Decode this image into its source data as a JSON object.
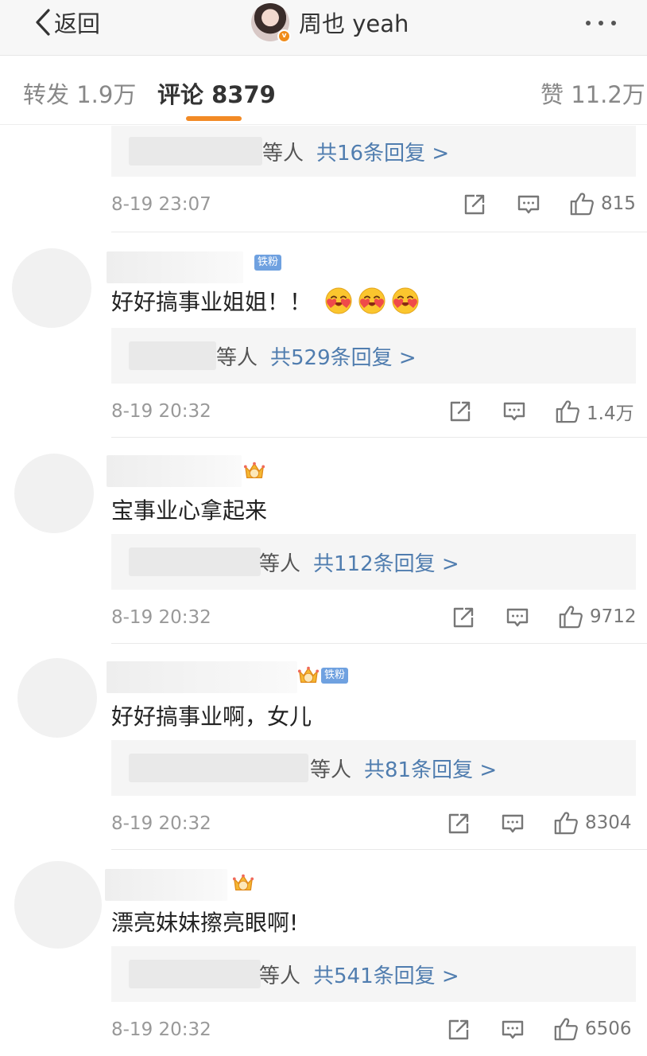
{
  "nav": {
    "back_label": "返回",
    "title": "周也 yeah",
    "verified_mark": "v",
    "icons": {
      "back": "chevron-left-icon",
      "more": "more-dots-icon"
    }
  },
  "tabs": [
    {
      "label": "转发 1.9万"
    },
    {
      "label": "评论 8379",
      "active": true
    },
    {
      "label": "赞 11.2万"
    }
  ],
  "colors": {
    "accent": "#f28a25",
    "link": "#507daf",
    "fan_badge": "#6fa1e0"
  },
  "top_partial": {
    "reply_who": "等人",
    "reply_count": "共16条回复 >",
    "time": "8-19 23:07",
    "likes": "815"
  },
  "comments": [
    {
      "badges": [
        "铁粉"
      ],
      "text": "好好搞事业姐姐！！",
      "emoji_count": 3,
      "reply_who": "等人",
      "reply_count": "共529条回复 >",
      "time": "8-19 20:32",
      "likes": "1.4万"
    },
    {
      "badges": [
        "crown-4"
      ],
      "text": "宝事业心拿起来",
      "reply_who": "等人",
      "reply_count": "共112条回复 >",
      "time": "8-19 20:32",
      "likes": "9712"
    },
    {
      "badges": [
        "crown-7",
        "铁粉"
      ],
      "text": "好好搞事业啊，女儿",
      "reply_who": "等人",
      "reply_count": "共81条回复 >",
      "time": "8-19 20:32",
      "likes": "8304"
    },
    {
      "badges": [
        "crown-3"
      ],
      "text": "漂亮妹妹擦亮眼啊!",
      "reply_who": "等人",
      "reply_count": "共541条回复 >",
      "time": "8-19 20:32",
      "likes": "6506"
    }
  ],
  "action_icons": [
    "share-icon",
    "comment-icon",
    "thumbs-up-icon"
  ]
}
